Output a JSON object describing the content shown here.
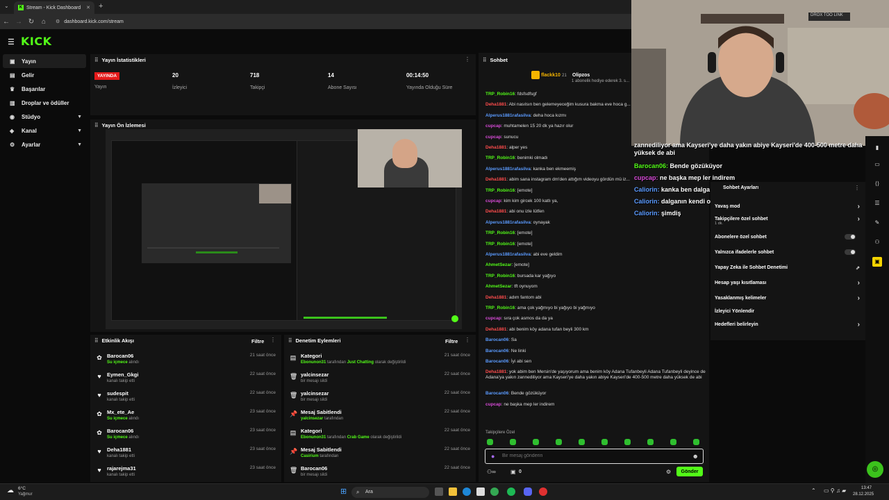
{
  "browser": {
    "tab_title": "Stream - Kick Dashboard",
    "url": "dashboard.kick.com/stream"
  },
  "header": {
    "logo": "KICK"
  },
  "sidebar": {
    "items": [
      {
        "label": "Yayın",
        "icon": "broadcast-icon"
      },
      {
        "label": "Gelir",
        "icon": "wallet-icon"
      },
      {
        "label": "Başarılar",
        "icon": "trophy-icon"
      },
      {
        "label": "Droplar ve ödüller",
        "icon": "gift-icon"
      },
      {
        "label": "Stüdyo",
        "icon": "studio-icon"
      },
      {
        "label": "Kanal",
        "icon": "channel-icon"
      },
      {
        "label": "Ayarlar",
        "icon": "gear-icon"
      }
    ]
  },
  "stats": {
    "title": "Yayın İstatistikleri",
    "live_badge": "YAYINDA",
    "live_label": "Yayın",
    "viewers_value": "20",
    "viewers_label": "İzleyici",
    "followers_value": "718",
    "followers_label": "Takipçi",
    "subs_value": "14",
    "subs_label": "Abone Sayısı",
    "uptime_value": "00:14:50",
    "uptime_label": "Yayında Olduğu Süre"
  },
  "preview": {
    "title": "Yayın Ön İzlemesi"
  },
  "activity": {
    "title": "Etkinlik Akışı",
    "filter": "Filtre",
    "rows": [
      {
        "name": "Barocan06",
        "action": "Su içmece",
        "suffix": "alındı",
        "time": "21 saat önce",
        "icon": "gift"
      },
      {
        "name": "Eymen_Gkgi",
        "action": "",
        "suffix": "kanalı takip etti",
        "time": "22 saat önce",
        "icon": "heart"
      },
      {
        "name": "sudespit",
        "action": "",
        "suffix": "kanalı takip etti",
        "time": "22 saat önce",
        "icon": "heart"
      },
      {
        "name": "Mx_ete_Ae",
        "action": "Su içmece",
        "suffix": "alındı",
        "time": "23 saat önce",
        "icon": "gift"
      },
      {
        "name": "Barocan06",
        "action": "Su içmece",
        "suffix": "alındı",
        "time": "23 saat önce",
        "icon": "gift"
      },
      {
        "name": "Deha1881",
        "action": "",
        "suffix": "kanalı takip etti",
        "time": "23 saat önce",
        "icon": "heart"
      },
      {
        "name": "rajarejma31",
        "action": "",
        "suffix": "kanalı takip etti",
        "time": "23 saat önce",
        "icon": "heart"
      }
    ]
  },
  "moderation": {
    "title": "Denetim Eylemleri",
    "filter": "Filtre",
    "rows": [
      {
        "name": "Kategori",
        "who": "Ebonunon31",
        "mid": "tarafından",
        "green": "Just Chatting",
        "end": "olarak değiştirildi",
        "time": "21 saat önce"
      },
      {
        "name": "yalcinsezar",
        "who": "",
        "mid": "",
        "green": "",
        "end": "bir mesajı sildi",
        "time": "22 saat önce"
      },
      {
        "name": "yalcinsezar",
        "who": "",
        "mid": "",
        "green": "",
        "end": "bir mesajı sildi",
        "time": "22 saat önce"
      },
      {
        "name": "Mesaj Sabitlendi",
        "who": "yalcinsezar",
        "mid": "tarafından",
        "green": "",
        "end": "",
        "time": "22 saat önce"
      },
      {
        "name": "Kategori",
        "who": "Ebonunon31",
        "mid": "tarafından",
        "green": "Crab Game",
        "end": "olarak değiştirildi",
        "time": "22 saat önce"
      },
      {
        "name": "Mesaj Sabitlendi",
        "who": "Casirium",
        "mid": "tarafından",
        "green": "",
        "end": "",
        "time": "22 saat önce"
      },
      {
        "name": "Barocan06",
        "who": "",
        "mid": "",
        "green": "",
        "end": "bir mesajı sildi",
        "time": "22 saat önce"
      }
    ]
  },
  "chat": {
    "title": "Sohbet",
    "pinned_user": "flackk10",
    "pinned_count": "21",
    "pinned_user2": "Olipzos",
    "pinned_text": "1 abonelik hediye ederek 3. s...",
    "messages": [
      {
        "user": "TRP_Robin16",
        "color": "green",
        "text": "fdsfsdfsgf"
      },
      {
        "user": "Deha1881",
        "color": "red",
        "text": "Abi nasılsın ben gelemeyeceğim kusura bakma eve hoca g..."
      },
      {
        "user": "Alperus1881rafasilva",
        "color": "blue",
        "text": "deha hoca kızmı"
      },
      {
        "user": "cupcap",
        "color": "pink",
        "text": "muhtamelen 15 20 dk ya hazır olur"
      },
      {
        "user": "cupcap",
        "color": "pink",
        "text": "sunucu"
      },
      {
        "user": "Deha1881",
        "color": "red",
        "text": "alper yes"
      },
      {
        "user": "TRP_Robin16",
        "color": "green",
        "text": "benimki olmadı"
      },
      {
        "user": "Alperus1881rafasilva",
        "color": "blue",
        "text": "kanka ben ekmeemiş"
      },
      {
        "user": "Deha1881",
        "color": "red",
        "text": "abim sana instagram dm'den attığım videoyu gördün mü iz..."
      },
      {
        "user": "TRP_Robin16",
        "color": "green",
        "text": "[emote]"
      },
      {
        "user": "cupcap",
        "color": "pink",
        "text": "kim kim gircek 100 katlı ya,"
      },
      {
        "user": "Deha1881",
        "color": "red",
        "text": "abi onu izle lütfen"
      },
      {
        "user": "Alperus1881rafasilva",
        "color": "blue",
        "text": "oynayak"
      },
      {
        "user": "TRP_Robin16",
        "color": "green",
        "text": "[emote]"
      },
      {
        "user": "TRP_Robin16",
        "color": "green",
        "text": "[emote]"
      },
      {
        "user": "Alperus1881rafasilva",
        "color": "blue",
        "text": "abi eve geldim"
      },
      {
        "user": "AhmetSezar",
        "color": "green",
        "text": "[emote]"
      },
      {
        "user": "TRP_Robin16",
        "color": "green",
        "text": "bursada kar yağıyo"
      },
      {
        "user": "AhmetSezar",
        "color": "green",
        "text": "tft oynuyom"
      },
      {
        "user": "Deha1881",
        "color": "red",
        "text": "adım fantom abi"
      },
      {
        "user": "TRP_Robin16",
        "color": "green",
        "text": "ama çok yağmıyo bi yağıyo bi yağmıyo"
      },
      {
        "user": "cupcap",
        "color": "pink",
        "text": "sıra çok asmos da da ya"
      },
      {
        "user": "Deha1881",
        "color": "red",
        "text": "abi benim köy adana tufan beyli 300 km"
      },
      {
        "user": "Barocan06",
        "color": "blue",
        "text": "Sa"
      },
      {
        "user": "Barocan06",
        "color": "blue",
        "text": "Ne linki"
      },
      {
        "user": "Barocan06",
        "color": "blue",
        "text": "İyi abi sen"
      },
      {
        "user": "Deha1881",
        "color": "red",
        "text": "yok abim ben Mersin'de yaşıyorum ama benim köy Adana Tufanbeyli Adana Tufanbeyli deyince de Adana'ya yakın zannediliyor ama Kayseri'ye daha yakın abiye Kayseri'de 400-500 metre daha yüksek de abi"
      },
      {
        "user": "Barocan06",
        "color": "blue",
        "text": "Bende gözüküyor"
      },
      {
        "user": "cupcap",
        "color": "pink",
        "text": "ne başka mep ler indirem"
      }
    ],
    "followers_only": "Takipçilere Özel",
    "input_placeholder": "Bir mesaj gönderin",
    "send_label": "Gönder",
    "counter": "0"
  },
  "overlay": {
    "lines": [
      {
        "user": "",
        "text": "zannediliyor ama Kayseri'ye daha yakın abiye Kayseri'de 400-500 metre daha yüksek de abi"
      },
      {
        "user": "Barocan06:",
        "text": "Bende gözüküyor"
      },
      {
        "user": "cupcap:",
        "text": "ne başka mep ler indirem"
      },
      {
        "user": "Caliorin:",
        "text": "kanka ben dalga olmuşum"
      },
      {
        "user": "Caliorin:",
        "text": "dalganın kendi olmuşum KJHCKASLJLCŞAS"
      },
      {
        "user": "Caliorin:",
        "text": "şimdiş"
      }
    ]
  },
  "settings": {
    "title": "Sohbet Ayarları",
    "rows": [
      {
        "label": "Yavaş mod",
        "sub": "",
        "type": "arrow"
      },
      {
        "label": "Takipçilere özel sohbet",
        "sub": "1 dk.",
        "type": "arrow"
      },
      {
        "label": "Abonelere özel sohbet",
        "sub": "",
        "type": "toggle"
      },
      {
        "label": "Yalnızca ifadelerle sohbet",
        "sub": "",
        "type": "toggle"
      },
      {
        "label": "Yapay Zeka ile Sohbet Denetimi",
        "sub": "",
        "type": "external"
      },
      {
        "label": "Hesap yaşı kısıtlaması",
        "sub": "",
        "type": "arrow"
      },
      {
        "label": "Yasaklanmış kelimeler",
        "sub": "",
        "type": "arrow"
      },
      {
        "label": "İzleyici Yönlendir",
        "sub": "",
        "type": "none"
      },
      {
        "label": "Hedefleri belirleyin",
        "sub": "",
        "type": "arrow"
      }
    ]
  },
  "webcam": {
    "sign": "DROX TOO LINK"
  },
  "taskbar": {
    "weather_temp": "6°C",
    "weather_label": "Yağmur",
    "search_label": "Ara",
    "time": "13:47",
    "date": "28.12.2025"
  },
  "colors": {
    "accent": "#53fc18",
    "live": "#e51b1b",
    "panel": "#141414",
    "bg": "#0b0b0b"
  }
}
